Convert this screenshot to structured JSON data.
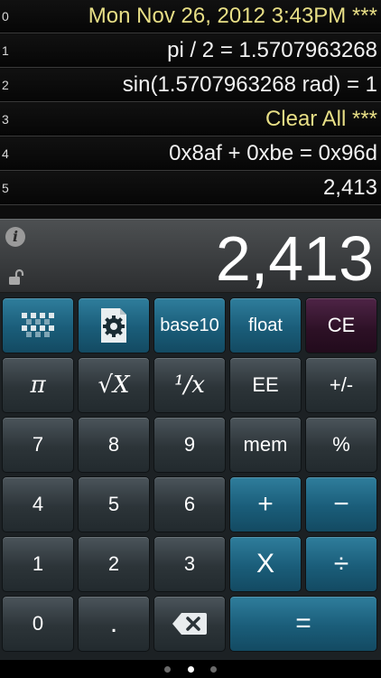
{
  "tape": [
    {
      "index": "0",
      "text": "Mon Nov 26, 2012 3:43PM ***",
      "kind": "note"
    },
    {
      "index": "1",
      "text": "pi / 2 = 1.5707963268",
      "kind": "calc"
    },
    {
      "index": "2",
      "text": "sin(1.5707963268 rad) = 1",
      "kind": "calc"
    },
    {
      "index": "3",
      "text": "Clear All ***",
      "kind": "note"
    },
    {
      "index": "4",
      "text": "0x8af + 0xbe = 0x96d",
      "kind": "calc"
    },
    {
      "index": "5",
      "text": "2,413",
      "kind": "calc"
    }
  ],
  "display": {
    "info_label": "i",
    "value": "2,413"
  },
  "keys": {
    "row1": {
      "grid": "grid-icon",
      "gear": "gear-icon",
      "base": "base10",
      "mode": "float",
      "clear_entry": "CE"
    },
    "row2": {
      "pi": "π",
      "sqrt": "√X",
      "recip": "¹/x",
      "ee": "EE",
      "sign": "+/-"
    },
    "row3": {
      "seven": "7",
      "eight": "8",
      "nine": "9",
      "mem": "mem",
      "percent": "%"
    },
    "row4": {
      "four": "4",
      "five": "5",
      "six": "6",
      "plus": "+",
      "minus": "−"
    },
    "row5": {
      "one": "1",
      "two": "2",
      "three": "3",
      "times": "X",
      "divide": "÷"
    },
    "row6": {
      "zero": "0",
      "point": ".",
      "backspace": "backspace-icon",
      "equals": "="
    }
  },
  "pager": {
    "count": 3,
    "active": 1
  },
  "colors": {
    "note_text": "#e8df86",
    "blue_key": "#1a5d79",
    "gray_key": "#2c3438",
    "purple_key": "#2c1025"
  }
}
